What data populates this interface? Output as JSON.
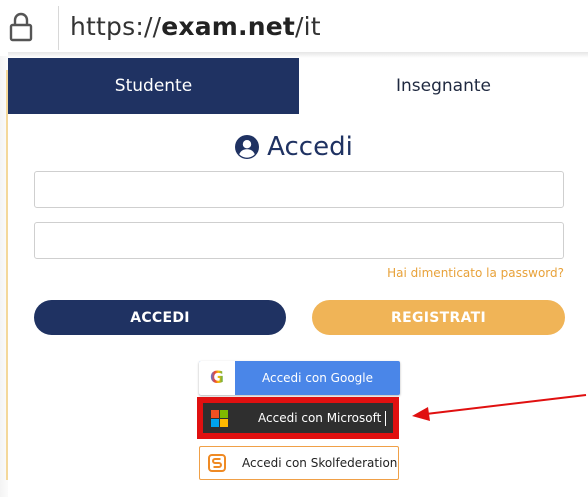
{
  "address_bar": {
    "url_prefix": "https://",
    "url_domain": "exam.net",
    "url_path": "/it",
    "lock_icon": "lock-icon"
  },
  "tabs": [
    {
      "label": "Studente",
      "active": true
    },
    {
      "label": "Insegnante",
      "active": false
    }
  ],
  "login": {
    "heading": "Accedi",
    "heading_icon": "user-circle-icon",
    "username_value": "",
    "password_value": "",
    "forgot_password": "Hai dimenticato la password?",
    "accedi_button": "ACCEDI",
    "registrati_button": "REGISTRATI"
  },
  "sso": {
    "google": {
      "label": "Accedi con Google",
      "icon_glyph": "G",
      "icon": "google-icon"
    },
    "microsoft": {
      "label": "Accedi con Microsoft",
      "icon": "microsoft-icon"
    },
    "skolfederation": {
      "label": "Accedi con Skolfederation",
      "icon": "skolfederation-icon"
    }
  },
  "colors": {
    "primary": "#1f3262",
    "accent": "#f0b457",
    "link": "#e8a23a",
    "google_blue": "#4a86e8",
    "highlight_red": "#e01010"
  }
}
